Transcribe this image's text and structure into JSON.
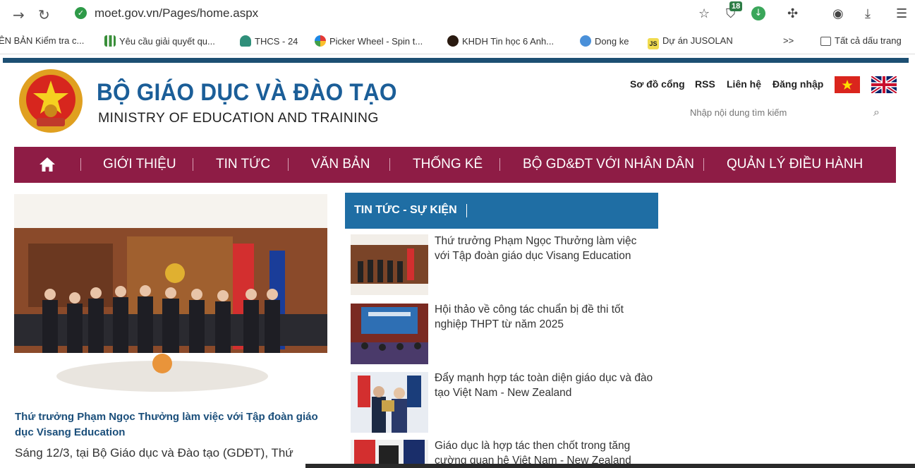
{
  "browser": {
    "url": "moet.gov.vn/Pages/home.aspx",
    "extension_badge": "18",
    "bookmarks": [
      "ÊN BẢN Kiểm tra c...",
      "Yêu cầu giải quyết qu...",
      "THCS - 24",
      "Picker Wheel - Spin t...",
      "KHDH Tin học 6 Anh...",
      "Dong ke",
      "Dự án JUSOLAN",
      ">>",
      "Tất cả dấu trang"
    ]
  },
  "header": {
    "title": "BỘ GIÁO DỤC VÀ ĐÀO TẠO",
    "subtitle": "MINISTRY OF EDUCATION AND TRAINING",
    "links": [
      "Sơ đồ cổng",
      "RSS",
      "Liên hệ",
      "Đăng nhập"
    ],
    "search_placeholder": "Nhập nội dung tìm kiếm"
  },
  "nav": {
    "items": [
      "GIỚI THIỆU",
      "TIN TỨC",
      "VĂN BẢN",
      "THỐNG KÊ",
      "BỘ GD&ĐT VỚI NHÂN DÂN",
      "QUẢN LÝ ĐIỀU HÀNH"
    ]
  },
  "feature": {
    "title": "Thứ trưởng Phạm Ngọc Thưởng làm việc với Tập đoàn giáo dục Visang Education",
    "summary": "Sáng 12/3, tại Bộ Giáo dục và Đào tạo (GDĐT), Thứ"
  },
  "news": {
    "heading": "TIN TỨC - SỰ KIỆN",
    "items": [
      {
        "title": "Thứ trưởng Phạm Ngọc Thưởng làm việc với Tập đoàn giáo dục Visang Education"
      },
      {
        "title": "Hội thảo về công tác chuẩn bị đề thi tốt nghiệp THPT từ năm 2025"
      },
      {
        "title": "Đẩy mạnh hợp tác toàn diện giáo dục và đào tạo Việt Nam - New Zealand"
      },
      {
        "title": "Giáo dục là hợp tác then chốt trong tăng cường quan hệ Việt Nam - New Zealand"
      }
    ]
  },
  "colors": {
    "nav_bg": "#8e1c45",
    "news_head_bg": "#1f6ea4",
    "title_blue": "#1b5e98",
    "top_stripe": "#1d4f73"
  }
}
